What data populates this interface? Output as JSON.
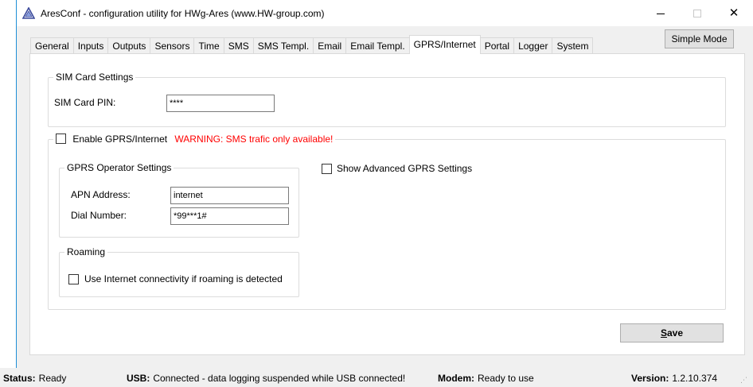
{
  "window": {
    "title": "AresConf - configuration utility for HWg-Ares (www.HW-group.com)",
    "controls": {
      "minimize": "minimize",
      "maximize": "maximize",
      "close": "✕"
    }
  },
  "tabs": [
    {
      "label": "General"
    },
    {
      "label": "Inputs"
    },
    {
      "label": "Outputs"
    },
    {
      "label": "Sensors"
    },
    {
      "label": "Time"
    },
    {
      "label": "SMS"
    },
    {
      "label": "SMS Templ."
    },
    {
      "label": "Email"
    },
    {
      "label": "Email Templ."
    },
    {
      "label": "GPRS/Internet",
      "active": true
    },
    {
      "label": "Portal"
    },
    {
      "label": "Logger"
    },
    {
      "label": "System"
    }
  ],
  "simple_mode_label": "Simple Mode",
  "sim": {
    "group_title": "SIM Card Settings",
    "pin_label": "SIM Card PIN:",
    "pin_value": "****"
  },
  "gprs": {
    "enable_label": "Enable GPRS/Internet",
    "enable_checked": false,
    "warning": "WARNING: SMS trafic only available!",
    "operator_title": "GPRS Operator Settings",
    "apn_label": "APN Address:",
    "apn_value": "internet",
    "dial_label": "Dial Number:",
    "dial_value": "*99***1#",
    "advanced_label": "Show Advanced GPRS Settings",
    "advanced_checked": false,
    "roaming_title": "Roaming",
    "roaming_label": "Use Internet connectivity if roaming is detected",
    "roaming_checked": false
  },
  "save_label_first": "S",
  "save_label_rest": "ave",
  "status": {
    "status_key": "Status:",
    "status_val": "Ready",
    "usb_key": "USB:",
    "usb_val": "Connected - data logging suspended while USB connected!",
    "modem_key": "Modem:",
    "modem_val": "Ready to use",
    "version_key": "Version:",
    "version_val": "1.2.10.374"
  },
  "colors": {
    "warning": "#ff0000",
    "accent_border": "#1e8fd6"
  }
}
